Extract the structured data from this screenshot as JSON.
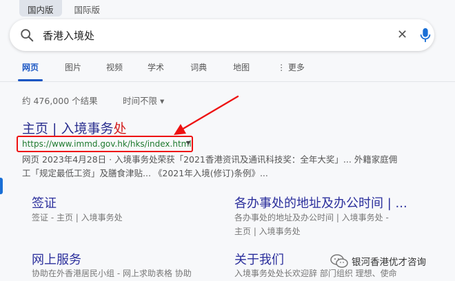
{
  "region_tabs": [
    "国内版",
    "国际版"
  ],
  "search": {
    "query": "香港入境处"
  },
  "nav_tabs": [
    "网页",
    "图片",
    "视频",
    "学术",
    "词典",
    "地图",
    "⋮ 更多"
  ],
  "result_stats": "约 476,000 个结果",
  "time_filter": "时间不限 ▾",
  "result": {
    "title_main": "主页 | 入境事务",
    "title_end": "处",
    "url": "https://www.immd.gov.hk/hks/index.html",
    "snippet_line1": "网页 2023年4月28日 · 入境事务处荣获「2021香港资讯及通讯科技奖：全年大奖」... 外籍家庭佣",
    "snippet_line2": "工「规定最低工资」及膳食津贴... 《2021年入境(修订)条例》..."
  },
  "sitelinks": [
    {
      "title": "签证",
      "desc": "签证 - 主页 | 入境事务处"
    },
    {
      "title": "各办事处的地址及办公时间 | ...",
      "desc1": "各办事处的地址及办公时间 | 入境事务处 -",
      "desc2": "主页 | 入境事务处"
    },
    {
      "title": "网上服务",
      "desc": "协助在外香港居民小组 - 网上求助表格 协助"
    },
    {
      "title": "关于我们",
      "desc": "入境事务处处长欢迎辞 部门组织 理想、使命"
    }
  ],
  "watermark": "银河香港优才咨询",
  "colors": {
    "link": "#2b2f9c",
    "url_green": "#1e7a2e",
    "highlight_red": "#e11",
    "active_blue": "#1a56c4"
  }
}
